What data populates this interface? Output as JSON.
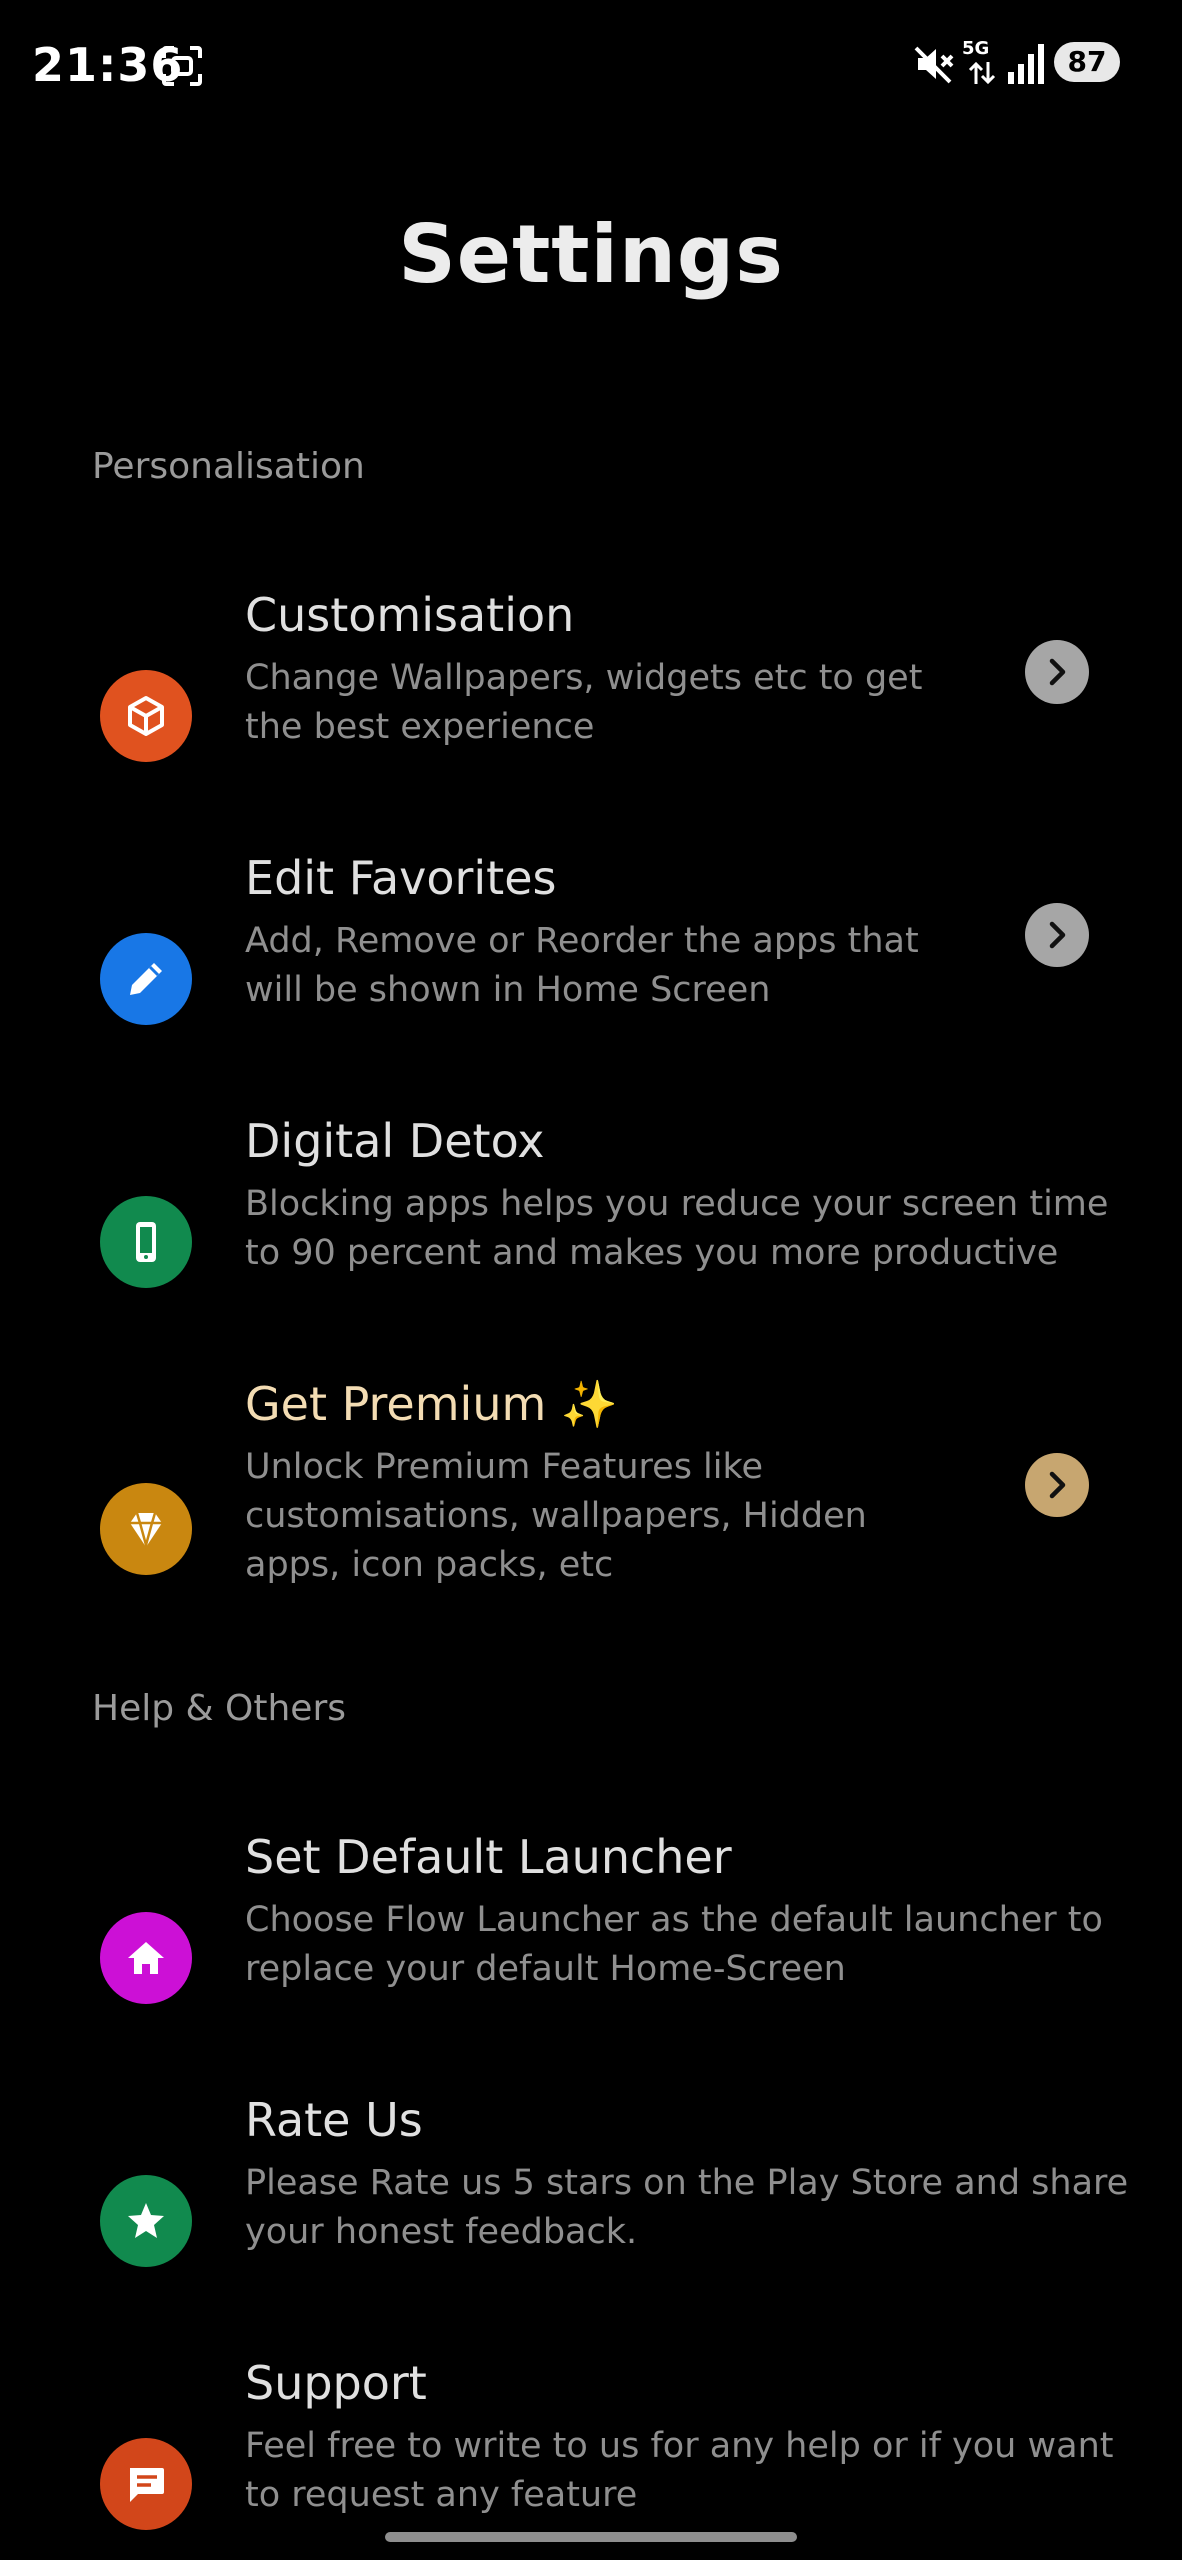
{
  "status_bar": {
    "time": "21:36",
    "network": "5G",
    "battery": "87"
  },
  "title": "Settings",
  "sections": [
    {
      "header": "Personalisation",
      "items": [
        {
          "title": "Customisation",
          "description_lines": [
            "Change Wallpapers, widgets etc to get",
            "the best experience"
          ],
          "icon": "cube-icon",
          "color": "#e0521f",
          "has_chevron": true
        },
        {
          "title": "Edit Favorites",
          "description_lines": [
            "Add, Remove or Reorder the apps that",
            "will be shown in Home Screen"
          ],
          "icon": "pencil-icon",
          "color": "#1877e6",
          "has_chevron": true
        },
        {
          "title": "Digital Detox",
          "description_lines": [
            "Blocking apps helps you reduce your screen time",
            "to 90 percent and makes you more productive"
          ],
          "icon": "phone-icon",
          "color": "#118a4e",
          "has_chevron": false
        },
        {
          "title": "Get Premium ✨",
          "description_lines": [
            "Unlock Premium Features like",
            "customisations, wallpapers, Hidden",
            "apps, icon packs, etc"
          ],
          "icon": "diamond-icon",
          "color": "#c98710",
          "has_chevron": true
        }
      ]
    },
    {
      "header": "Help & Others",
      "items": [
        {
          "title": "Set Default Launcher",
          "description_lines": [
            "Choose Flow Launcher as the default launcher to",
            "replace your default Home-Screen"
          ],
          "icon": "home-icon",
          "color": "#cc10d6"
        },
        {
          "title": "Rate Us",
          "description_lines": [
            "Please Rate us 5 stars on the Play Store and share",
            "your honest feedback."
          ],
          "icon": "star-icon",
          "color": "#118a4e"
        },
        {
          "title": "Support",
          "description_lines": [
            "Feel free to write to us for any help or if you want",
            "to request any feature"
          ],
          "icon": "chat-icon",
          "color": "#d2461a"
        }
      ]
    }
  ]
}
